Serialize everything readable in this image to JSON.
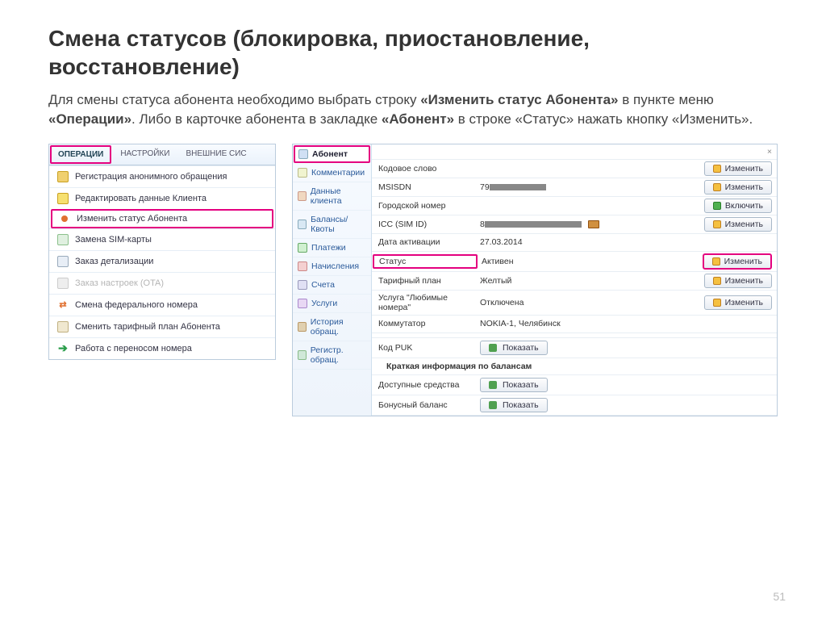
{
  "title": "Смена статусов (блокировка, приостановление, восстановление)",
  "desc_parts": {
    "p1": "Для смены статуса абонента необходимо выбрать строку ",
    "b1": "«Изменить статус Абонента»",
    "p2": " в пункте меню ",
    "b2": "«Операции»",
    "p3": ". Либо в карточке абонента в закладке ",
    "b3": "«Абонент»",
    "p4": " в строке «Статус» нажать кнопку «Изменить»."
  },
  "ops": {
    "tabs": {
      "operations": "ОПЕРАЦИИ",
      "settings": "НАСТРОЙКИ",
      "external": "ВНЕШНИЕ СИС"
    },
    "items": [
      {
        "label": "Регистрация анонимного обращения",
        "icon": "doc"
      },
      {
        "label": "Редактировать данные Клиента",
        "icon": "edit"
      },
      {
        "label": "Изменить статус Абонента",
        "icon": "dot",
        "hilite": true
      },
      {
        "label": "Замена SIM-карты",
        "icon": "sim"
      },
      {
        "label": "Заказ детализации",
        "icon": "calc"
      },
      {
        "label": "Заказ настроек (OTA)",
        "icon": "grey",
        "disabled": true
      },
      {
        "label": "Смена федерального номера",
        "icon": "swap"
      },
      {
        "label": "Сменить тарифный план Абонента",
        "icon": "cards"
      },
      {
        "label": "Работа с переносом номера",
        "icon": "arrow"
      }
    ]
  },
  "side": [
    {
      "label": "Абонент",
      "ico": "user",
      "active": true
    },
    {
      "label": "Комментарии",
      "ico": "comm"
    },
    {
      "label": "Данные клиента",
      "ico": "data"
    },
    {
      "label": "Балансы/Квоты",
      "ico": "bal"
    },
    {
      "label": "Платежи",
      "ico": "pay"
    },
    {
      "label": "Начисления",
      "ico": "charge"
    },
    {
      "label": "Счета",
      "ico": "bill"
    },
    {
      "label": "Услуги",
      "ico": "serv"
    },
    {
      "label": "История обращ.",
      "ico": "hist"
    },
    {
      "label": "Регистр. обращ.",
      "ico": "reg"
    }
  ],
  "rows": [
    {
      "label": "Кодовое слово",
      "val": "",
      "btn": "Изменить",
      "btnico": "edit"
    },
    {
      "label": "MSISDN",
      "val_prefix": "79",
      "masked": 70,
      "btn": "Изменить",
      "btnico": "edit"
    },
    {
      "label": "Городской номер",
      "val": "",
      "btn": "Включить",
      "btnico": "plus"
    },
    {
      "label": "ICC (SIM ID)",
      "val_prefix": "8",
      "masked": 120,
      "btn": "Изменить",
      "btnico": "edit",
      "book": true
    },
    {
      "label": "Дата активации",
      "val": "27.03.2014"
    },
    {
      "label": "Статус",
      "val": "Активен",
      "btn": "Изменить",
      "btnico": "edit",
      "hilite": true
    },
    {
      "label": "Тарифный план",
      "val": "Желтый",
      "btn": "Изменить",
      "btnico": "edit"
    },
    {
      "label": "Услуга \"Любимые номера\"",
      "val": "Отключена",
      "btn": "Изменить",
      "btnico": "edit"
    },
    {
      "label": "Коммутатор",
      "val": "NOKIA-1, Челябинск"
    }
  ],
  "puk": {
    "label": "Код PUK",
    "btn": "Показать"
  },
  "balances": {
    "header": "Краткая информация по балансам",
    "rows": [
      {
        "label": "Доступные средства",
        "btn": "Показать"
      },
      {
        "label": "Бонусный баланс",
        "btn": "Показать"
      }
    ]
  },
  "page_number": "51",
  "close_x": "×"
}
